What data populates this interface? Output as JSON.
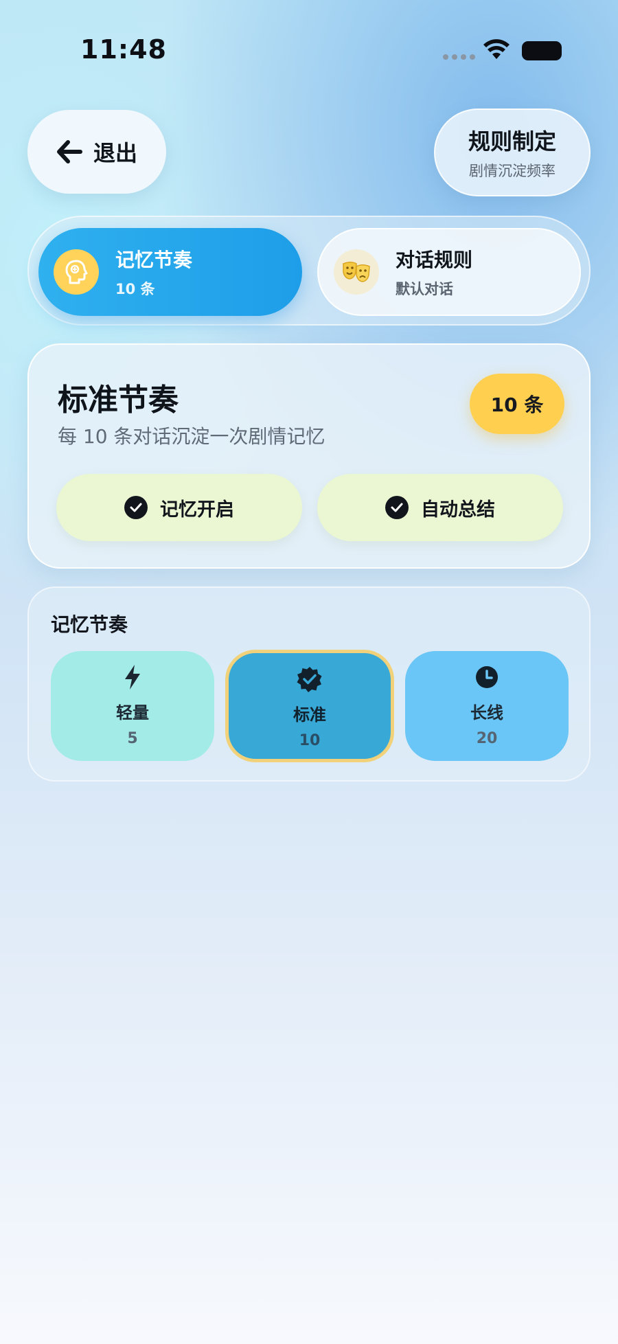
{
  "status": {
    "time": "11:48"
  },
  "header": {
    "exit_label": "退出",
    "rules_title": "规则制定",
    "rules_subtitle": "剧情沉淀频率"
  },
  "tabs": [
    {
      "title": "记忆节奏",
      "subtitle": "10 条",
      "icon": "brain-head-icon",
      "active": true
    },
    {
      "title": "对话规则",
      "subtitle": "默认对话",
      "icon": "theater-masks-icon",
      "active": false
    }
  ],
  "main_card": {
    "title": "标准节奏",
    "description": "每 10 条对话沉淀一次剧情记忆",
    "badge": "10 条",
    "pills": [
      {
        "label": "记忆开启",
        "icon": "check-circle-icon"
      },
      {
        "label": "自动总结",
        "icon": "check-circle-icon"
      }
    ]
  },
  "rhythm": {
    "heading": "记忆节奏",
    "options": [
      {
        "label": "轻量",
        "value": "5",
        "icon": "bolt-icon",
        "selected": false
      },
      {
        "label": "标准",
        "value": "10",
        "icon": "verified-badge-icon",
        "selected": true
      },
      {
        "label": "长线",
        "value": "20",
        "icon": "clock-icon",
        "selected": false
      }
    ]
  },
  "colors": {
    "accent_blue": "#1e9ee8",
    "badge_yellow": "#ffcf4f",
    "pill_green": "#eaf7d2",
    "option_light": "#a2ebe6",
    "option_standard": "#38a8d6",
    "option_long": "#69c6f6",
    "selected_border": "#f1d27a"
  }
}
